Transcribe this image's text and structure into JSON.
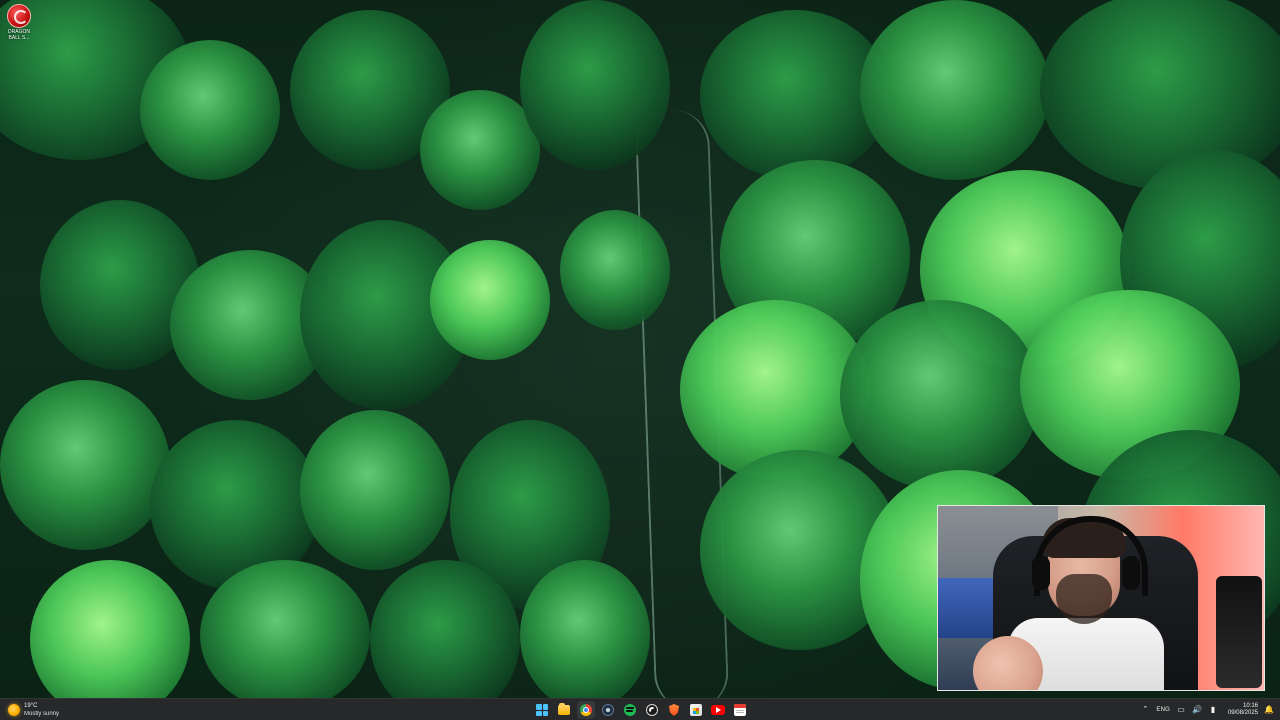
{
  "desktop": {
    "icons": [
      {
        "label_line1": "DRAGON",
        "label_line2": "BALL S..."
      }
    ]
  },
  "taskbar": {
    "weather": {
      "temp": "19°C",
      "desc": "Mostly sunny",
      "icon": "sun-icon"
    },
    "pinned": [
      {
        "name": "start",
        "icon": "windows-start-icon"
      },
      {
        "name": "file-explorer",
        "icon": "folder-icon"
      },
      {
        "name": "chrome",
        "icon": "chrome-icon"
      },
      {
        "name": "steam",
        "icon": "steam-icon"
      },
      {
        "name": "spotify",
        "icon": "spotify-icon"
      },
      {
        "name": "obs",
        "icon": "obs-icon"
      },
      {
        "name": "brave",
        "icon": "brave-icon"
      },
      {
        "name": "store",
        "icon": "store-icon"
      },
      {
        "name": "youtube",
        "icon": "youtube-icon"
      },
      {
        "name": "calendar",
        "icon": "calendar-icon"
      }
    ],
    "tray": {
      "language": "ENG",
      "time": "10:16",
      "date": "09/08/2025"
    }
  },
  "colors": {
    "taskbar_bg": "#141618",
    "accent_blue": "#4cc2ff",
    "youtube_red": "#ff0000",
    "spotify_green": "#1db954"
  }
}
